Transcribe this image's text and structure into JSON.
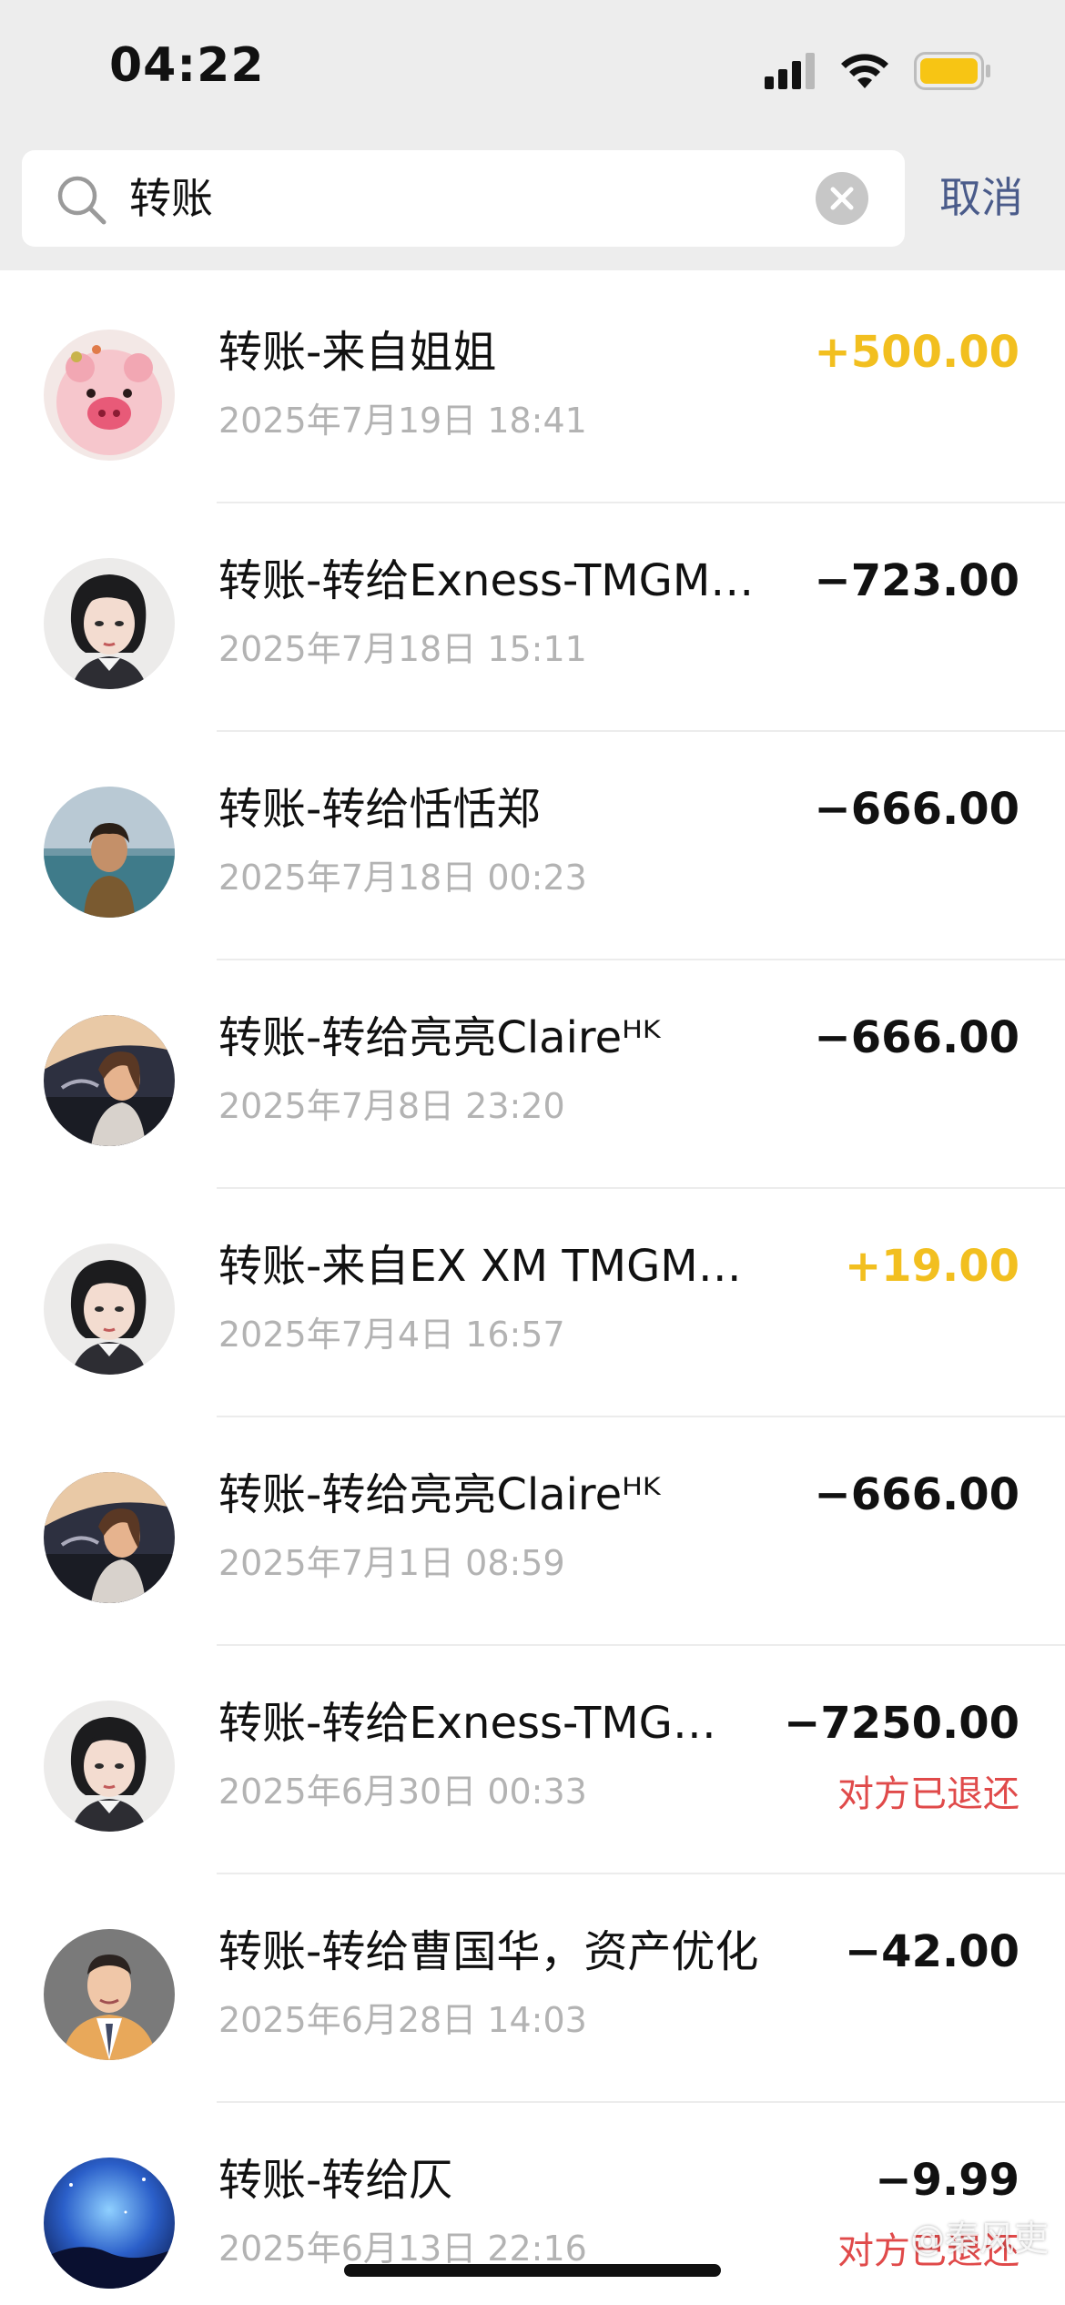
{
  "status_bar": {
    "time": "04:22",
    "battery_color": "#f7c514"
  },
  "search": {
    "query": "转账",
    "cancel_label": "取消"
  },
  "colors": {
    "income": "#f2bf1f",
    "refund_status": "#e04a4a",
    "cancel": "#4a5b8a"
  },
  "transactions": [
    {
      "title": "转账-来自姐姐",
      "date": "2025年7月19日 18:41",
      "amount": "+500.00",
      "type": "income",
      "status": "",
      "avatar": "pig-cartoon-avatar"
    },
    {
      "title": "转账-转给Exness-TMGM…",
      "date": "2025年7月18日 15:11",
      "amount": "−723.00",
      "type": "expense",
      "status": "",
      "avatar": "anime-girl-avatar"
    },
    {
      "title": "转账-转给恬恬郑",
      "date": "2025年7月18日 00:23",
      "amount": "−666.00",
      "type": "expense",
      "status": "",
      "avatar": "seaside-person-avatar"
    },
    {
      "title": "转账-转给亮亮Claireᴴᴷ",
      "date": "2025年7月8日 23:20",
      "amount": "−666.00",
      "type": "expense",
      "status": "",
      "avatar": "car-woman-avatar"
    },
    {
      "title": "转账-来自EX  XM  TMGM…",
      "date": "2025年7月4日 16:57",
      "amount": "+19.00",
      "type": "income",
      "status": "",
      "avatar": "anime-girl-avatar"
    },
    {
      "title": "转账-转给亮亮Claireᴴᴷ",
      "date": "2025年7月1日 08:59",
      "amount": "−666.00",
      "type": "expense",
      "status": "",
      "avatar": "car-woman-avatar"
    },
    {
      "title": "转账-转给Exness-TMG…",
      "date": "2025年6月30日 00:33",
      "amount": "−7250.00",
      "type": "expense",
      "status": "对方已退还",
      "avatar": "anime-girl-avatar"
    },
    {
      "title": "转账-转给曹国华，资产优化",
      "date": "2025年6月28日 14:03",
      "amount": "−42.00",
      "type": "expense",
      "status": "",
      "avatar": "man-suit-avatar"
    },
    {
      "title": "转账-转给仄",
      "date": "2025年6月13日 22:16",
      "amount": "−9.99",
      "type": "expense",
      "status": "对方已退还",
      "avatar": "night-sky-avatar"
    }
  ],
  "watermark": "@秦风吏"
}
